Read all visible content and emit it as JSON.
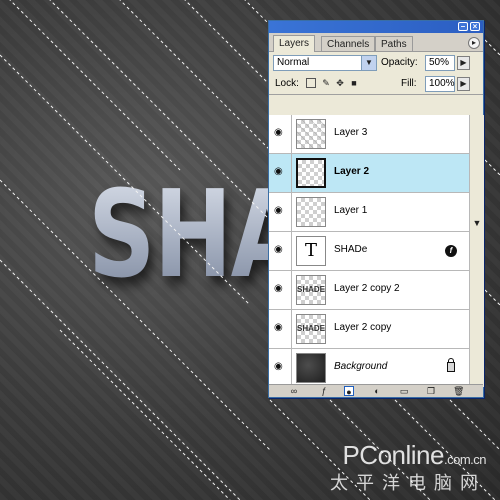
{
  "canvas": {
    "document_text": "SHA"
  },
  "panel": {
    "tabs": [
      {
        "label": "Layers",
        "active": true
      },
      {
        "label": "Channels",
        "active": false
      },
      {
        "label": "Paths",
        "active": false
      }
    ],
    "blend_mode": "Normal",
    "opacity_label": "Opacity:",
    "opacity_value": "50%",
    "lock_label": "Lock:",
    "fill_label": "Fill:",
    "fill_value": "100%",
    "layers": [
      {
        "name": "Layer 3",
        "selected": false,
        "style": "normal"
      },
      {
        "name": "Layer 2",
        "selected": true,
        "style": "bold"
      },
      {
        "name": "Layer 1",
        "selected": false,
        "style": "normal"
      },
      {
        "name": "SHADe",
        "selected": false,
        "style": "normal",
        "text_layer_glyph": "T"
      },
      {
        "name": "Layer 2 copy 2",
        "selected": false,
        "style": "normal",
        "thumb_text": "SHADE"
      },
      {
        "name": "Layer 2 copy",
        "selected": false,
        "style": "normal",
        "thumb_text": "SHADE"
      },
      {
        "name": "Background",
        "selected": false,
        "style": "italic"
      }
    ]
  },
  "watermark": {
    "brand_main": "PConline",
    "brand_domain": ".com.cn",
    "brand_cn": "太平洋电脑网"
  },
  "colors": {
    "selection_highlight": "#bde7f5",
    "titlebar": "#3a74d6",
    "panel_bg": "#ece9d8"
  }
}
